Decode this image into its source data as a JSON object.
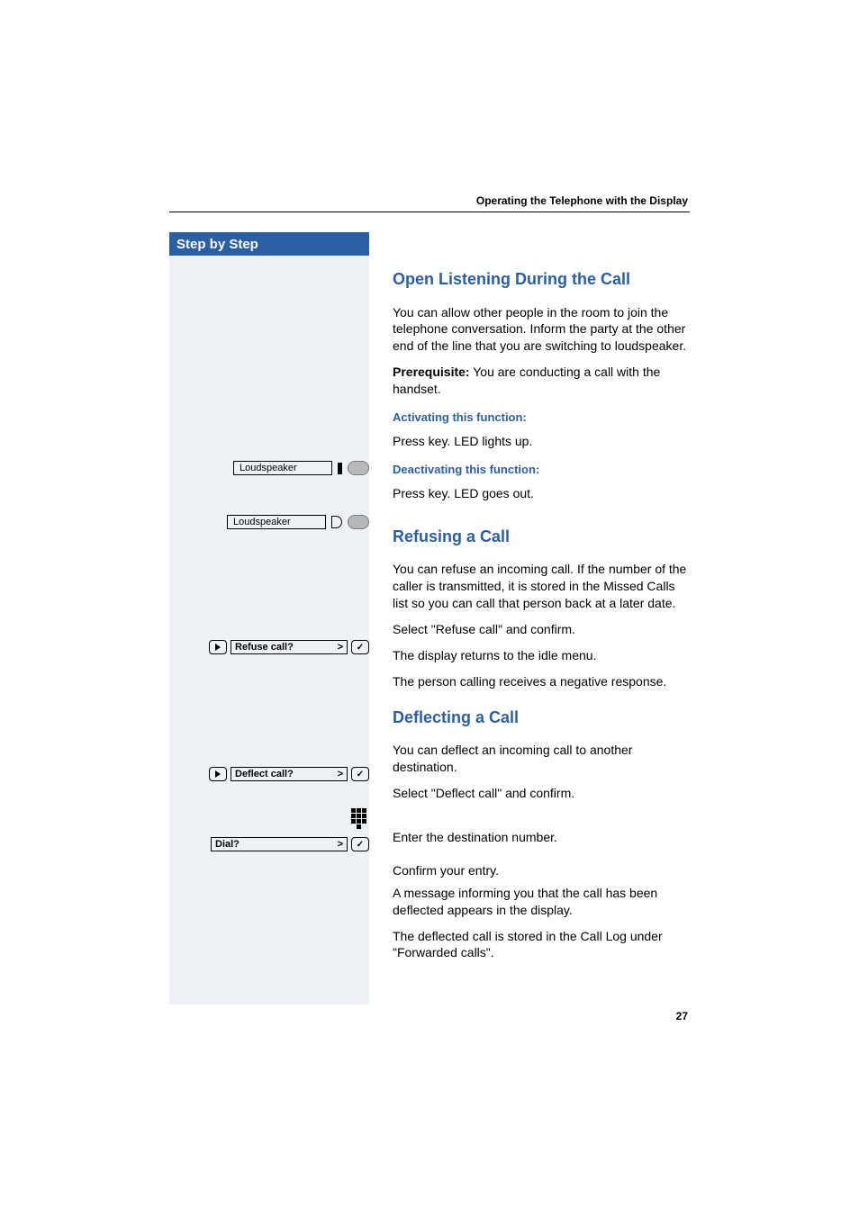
{
  "running_head": "Operating the Telephone with the Display",
  "sidebar": {
    "header": "Step by Step"
  },
  "page_number": "27",
  "widgets": {
    "loudspeaker_on": "Loudspeaker",
    "loudspeaker_off": "Loudspeaker",
    "refuse_menu": "Refuse call?",
    "deflect_menu": "Deflect call?",
    "dial_menu": "Dial?",
    "gt": ">"
  },
  "sections": {
    "open_listening": {
      "title": "Open Listening During the Call",
      "intro": "You can allow other people in the room to join the telephone conversation. Inform the party at the other end of the line that you are switching to loudspeaker.",
      "prereq_label": "Prerequisite:",
      "prereq_text": " You are conducting a call with the handset.",
      "activating_h": "Activating this function:",
      "activating_step": "Press key. LED lights up.",
      "deactivating_h": "Deactivating this function:",
      "deactivating_step": "Press key. LED goes out."
    },
    "refusing": {
      "title": "Refusing a Call",
      "intro": "You can refuse an incoming call. If the number of the caller is transmitted, it is stored in the Missed Calls list so you can call that person back at a later date.",
      "step1": "Select \"Refuse call\" and confirm.",
      "line2": "The display returns to the idle menu.",
      "line3": "The person calling receives a negative response."
    },
    "deflecting": {
      "title": "Deflecting a Call",
      "intro": "You can deflect an incoming call to another destination.",
      "step1": "Select \"Deflect call\" and confirm.",
      "step2": "Enter the destination number.",
      "step3": "Confirm your entry.",
      "line4": "A message informing you that the call has been deflected appears in the display.",
      "line5": "The deflected call is stored in the Call Log under \"Forwarded calls\"."
    }
  }
}
